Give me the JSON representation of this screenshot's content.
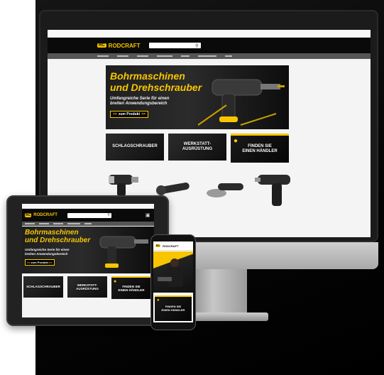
{
  "brand": {
    "name": "RODCRAFT",
    "mark": "RC",
    "accent": "#f7c600"
  },
  "hero": {
    "title_line1": "Bohrmaschinen",
    "title_line2": "und Drehschrauber",
    "sub_line1": "Umfangreiche Serie für einen",
    "sub_line2": "breiten Anwendungsbereich",
    "cta": "zum Produkt",
    "cta_arrows": ">>"
  },
  "tiles": {
    "schlagschrauber": "SCHLAGSCHRAUBER",
    "werkstatt_line1": "WERKSTATT-",
    "werkstatt_line2": "AUSRÜSTUNG",
    "haendler_line1": "FINDEN SIE",
    "haendler_line2": "EINEN HÄNDLER"
  },
  "icons": {
    "search": "search-icon",
    "pin": "map-pin-icon",
    "cart": "cart-icon"
  }
}
